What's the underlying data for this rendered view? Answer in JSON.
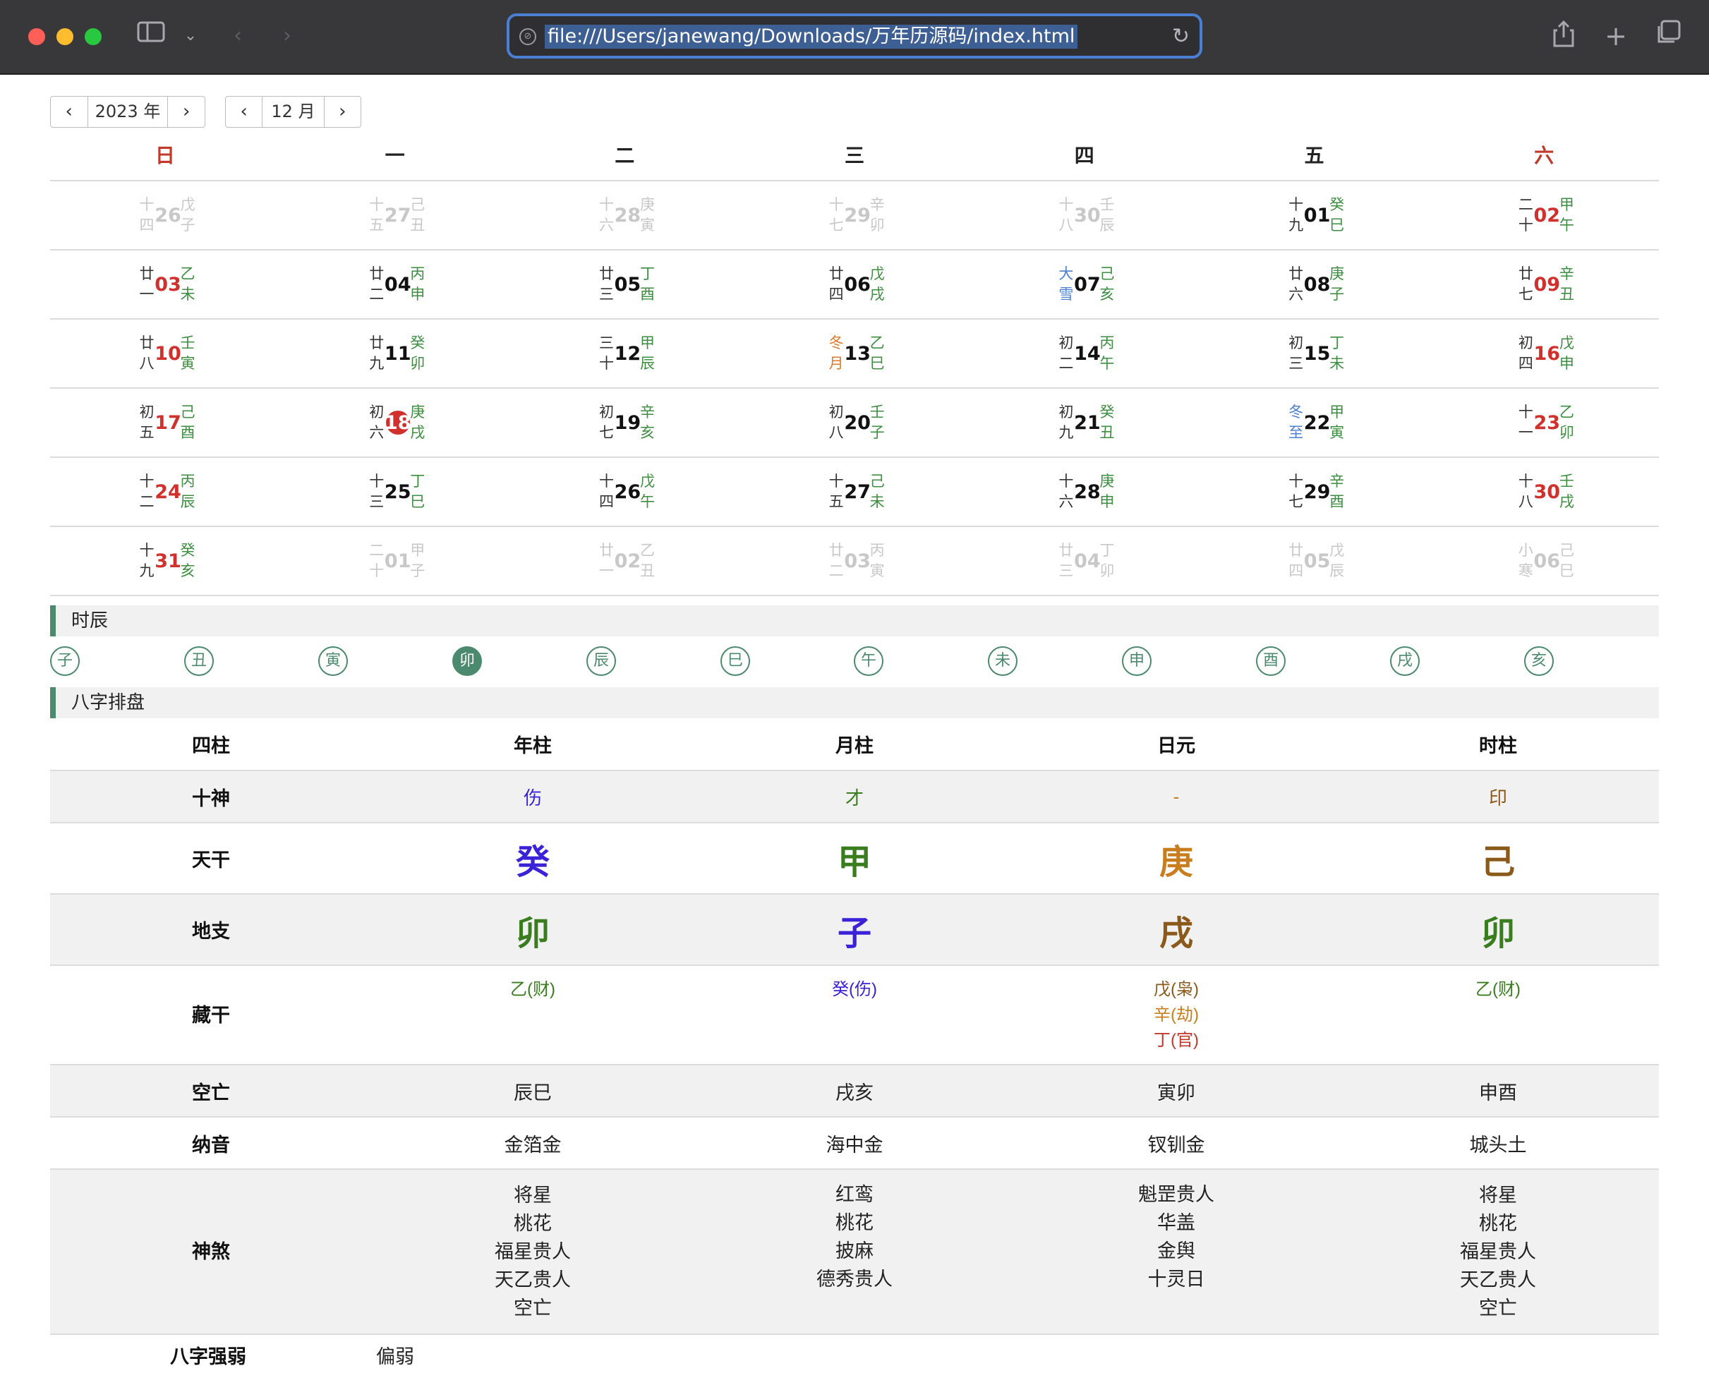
{
  "browser": {
    "url": "file:///Users/janewang/Downloads/万年历源码/index.html"
  },
  "selectors": {
    "year": "2023 年",
    "month": "12 月"
  },
  "weekdays": [
    "日",
    "一",
    "二",
    "三",
    "四",
    "五",
    "六"
  ],
  "calendar": [
    [
      {
        "lunar": "十四",
        "day": "26",
        "gz": "戊子",
        "muted": true
      },
      {
        "lunar": "十五",
        "day": "27",
        "gz": "己丑",
        "muted": true
      },
      {
        "lunar": "十六",
        "day": "28",
        "gz": "庚寅",
        "muted": true
      },
      {
        "lunar": "十七",
        "day": "29",
        "gz": "辛卯",
        "muted": true
      },
      {
        "lunar": "十八",
        "day": "30",
        "gz": "壬辰",
        "muted": true
      },
      {
        "lunar": "十九",
        "day": "01",
        "gz": "癸巳"
      },
      {
        "lunar": "二十",
        "day": "02",
        "gz": "甲午",
        "red": true
      }
    ],
    [
      {
        "lunar": "廿一",
        "day": "03",
        "gz": "乙未",
        "red": true
      },
      {
        "lunar": "廿二",
        "day": "04",
        "gz": "丙申"
      },
      {
        "lunar": "廿三",
        "day": "05",
        "gz": "丁酉"
      },
      {
        "lunar": "廿四",
        "day": "06",
        "gz": "戊戌"
      },
      {
        "lunar": "大雪",
        "day": "07",
        "gz": "己亥",
        "term2": true
      },
      {
        "lunar": "廿六",
        "day": "08",
        "gz": "庚子"
      },
      {
        "lunar": "廿七",
        "day": "09",
        "gz": "辛丑",
        "red": true
      }
    ],
    [
      {
        "lunar": "廿八",
        "day": "10",
        "gz": "壬寅",
        "red": true
      },
      {
        "lunar": "廿九",
        "day": "11",
        "gz": "癸卯"
      },
      {
        "lunar": "三十",
        "day": "12",
        "gz": "甲辰"
      },
      {
        "lunar": "冬月",
        "day": "13",
        "gz": "乙巳",
        "term": true
      },
      {
        "lunar": "初二",
        "day": "14",
        "gz": "丙午"
      },
      {
        "lunar": "初三",
        "day": "15",
        "gz": "丁未"
      },
      {
        "lunar": "初四",
        "day": "16",
        "gz": "戊申",
        "red": true
      }
    ],
    [
      {
        "lunar": "初五",
        "day": "17",
        "gz": "己酉",
        "red": true
      },
      {
        "lunar": "初六",
        "day": "18",
        "gz": "庚戌",
        "today": true
      },
      {
        "lunar": "初七",
        "day": "19",
        "gz": "辛亥"
      },
      {
        "lunar": "初八",
        "day": "20",
        "gz": "壬子"
      },
      {
        "lunar": "初九",
        "day": "21",
        "gz": "癸丑"
      },
      {
        "lunar": "冬至",
        "day": "22",
        "gz": "甲寅",
        "term2": true
      },
      {
        "lunar": "十一",
        "day": "23",
        "gz": "乙卯",
        "red": true
      }
    ],
    [
      {
        "lunar": "十二",
        "day": "24",
        "gz": "丙辰",
        "red": true
      },
      {
        "lunar": "十三",
        "day": "25",
        "gz": "丁巳"
      },
      {
        "lunar": "十四",
        "day": "26",
        "gz": "戊午"
      },
      {
        "lunar": "十五",
        "day": "27",
        "gz": "己未"
      },
      {
        "lunar": "十六",
        "day": "28",
        "gz": "庚申"
      },
      {
        "lunar": "十七",
        "day": "29",
        "gz": "辛酉"
      },
      {
        "lunar": "十八",
        "day": "30",
        "gz": "壬戌",
        "red": true
      }
    ],
    [
      {
        "lunar": "十九",
        "day": "31",
        "gz": "癸亥",
        "red": true
      },
      {
        "lunar": "二十",
        "day": "01",
        "gz": "甲子",
        "muted": true
      },
      {
        "lunar": "廿一",
        "day": "02",
        "gz": "乙丑",
        "muted": true
      },
      {
        "lunar": "廿二",
        "day": "03",
        "gz": "丙寅",
        "muted": true
      },
      {
        "lunar": "廿三",
        "day": "04",
        "gz": "丁卯",
        "muted": true
      },
      {
        "lunar": "廿四",
        "day": "05",
        "gz": "戊辰",
        "muted": true
      },
      {
        "lunar": "小寒",
        "day": "06",
        "gz": "己巳",
        "muted": true
      }
    ]
  ],
  "shichen": {
    "title": "时辰",
    "hours": [
      "子",
      "丑",
      "寅",
      "卯",
      "辰",
      "巳",
      "午",
      "未",
      "申",
      "酉",
      "戌",
      "亥"
    ],
    "active_index": 3
  },
  "bazi": {
    "title": "八字排盘",
    "headers": [
      "四柱",
      "年柱",
      "月柱",
      "日元",
      "时柱"
    ],
    "shishen": {
      "label": "十神",
      "values": [
        "伤",
        "才",
        "-",
        "印"
      ]
    },
    "tiangan": {
      "label": "天干",
      "values": [
        "癸",
        "甲",
        "庚",
        "己"
      ]
    },
    "dizhi": {
      "label": "地支",
      "values": [
        "卯",
        "子",
        "戌",
        "卯"
      ]
    },
    "canggan": {
      "label": "藏干",
      "values": [
        [
          "乙(财)"
        ],
        [
          "癸(伤)"
        ],
        [
          "戊(枭)",
          "辛(劫)",
          "丁(官)"
        ],
        [
          "乙(财)"
        ]
      ]
    },
    "kongwang": {
      "label": "空亡",
      "values": [
        "辰巳",
        "戌亥",
        "寅卯",
        "申酉"
      ]
    },
    "nayin": {
      "label": "纳音",
      "values": [
        "金箔金",
        "海中金",
        "钗钏金",
        "城头土"
      ]
    },
    "shensha": {
      "label": "神煞",
      "values": [
        [
          "将星",
          "桃花",
          "福星贵人",
          "天乙贵人",
          "空亡"
        ],
        [
          "红鸾",
          "桃花",
          "披麻",
          "德秀贵人"
        ],
        [
          "魁罡贵人",
          "华盖",
          "金舆",
          "十灵日"
        ],
        [
          "将星",
          "桃花",
          "福星贵人",
          "天乙贵人",
          "空亡"
        ]
      ]
    },
    "strength": {
      "label": "八字强弱",
      "value": "偏弱"
    }
  },
  "colors": {
    "accent_green": "#4c8a6f",
    "weekend_red": "#c0392b",
    "water_blue": "#3a22d8",
    "wood_green": "#3a7d1e",
    "metal_orange": "#c87e1e",
    "earth_brown": "#8b5a1a",
    "fire_red": "#c0392b"
  }
}
